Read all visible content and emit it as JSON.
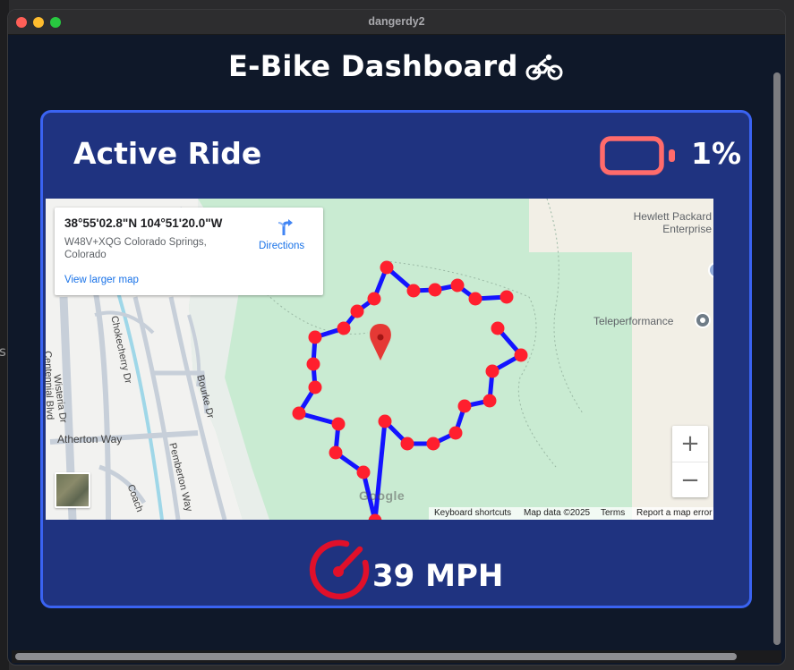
{
  "window": {
    "title": "dangerdy2"
  },
  "background": {
    "edge_letter": "s"
  },
  "page": {
    "title": "E-Bike Dashboard",
    "title_icon": "bicycle-icon"
  },
  "ride_card": {
    "title": "Active Ride",
    "battery_percent": "1%",
    "battery_level": 0.01,
    "speed_text": "39 MPH",
    "speed_icon": "speedometer-icon",
    "colors": {
      "card_bg": "#1f3380",
      "card_border": "#3a63f2",
      "battery": "#ff6b6b",
      "speedometer": "#e0102a",
      "route_line": "#1414ff",
      "route_points": "#ff1f2e"
    }
  },
  "map": {
    "info": {
      "coords": "38°55'02.8\"N 104°51'20.0\"W",
      "address": "W48V+XQG Colorado Springs, Colorado",
      "view_larger": "View larger map",
      "directions": "Directions"
    },
    "labels": {
      "hp": "Hewlett Packard Enterprise",
      "teleperformance": "Teleperformance",
      "atherton": "Atherton Way",
      "wisteria": "Wisteria Dr",
      "chokecherry": "Chokecherry Dr",
      "centennial": "Centennial Blvd",
      "bourke": "Bourke Dr",
      "pemberton": "Pemberton Way",
      "coach": "Coach",
      "google": "Google"
    },
    "zoom_in": "+",
    "zoom_out": "−",
    "attribution": {
      "shortcuts": "Keyboard shortcuts",
      "map_data": "Map data ©2025",
      "terms": "Terms",
      "report": "Report a map error"
    }
  }
}
